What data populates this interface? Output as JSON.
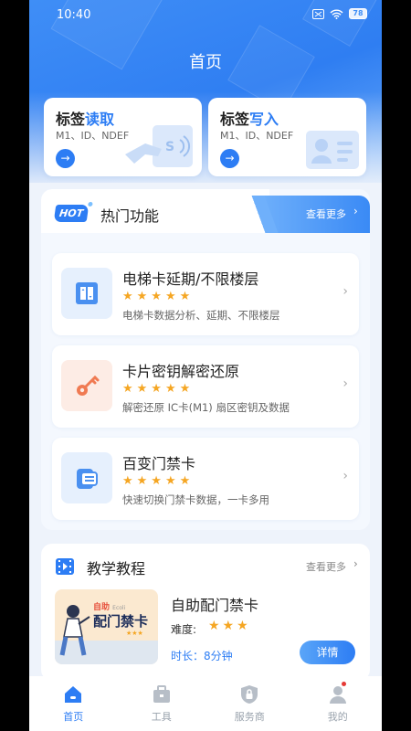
{
  "status_bar": {
    "time": "10:40",
    "battery": "78"
  },
  "header": {
    "title": "首页"
  },
  "tag_cards": [
    {
      "title_prefix": "标签",
      "title_highlight": "读取",
      "subtitle": "M1、ID、NDEF"
    },
    {
      "title_prefix": "标签",
      "title_highlight": "写入",
      "subtitle": "M1、ID、NDEF"
    }
  ],
  "hot": {
    "badge": "HOT",
    "title": "热门功能",
    "more": "查看更多",
    "items": [
      {
        "name": "电梯卡延期/不限楼层",
        "stars": "★★★★★",
        "desc": "电梯卡数据分析、延期、不限楼层",
        "icon": "elevator-icon"
      },
      {
        "name": "卡片密钥解密还原",
        "stars": "★★★★★",
        "desc": "解密还原 IC卡(M1) 扇区密钥及数据",
        "icon": "key-icon"
      },
      {
        "name": "百变门禁卡",
        "stars": "★★★★★",
        "desc": "快速切换门禁卡数据，一卡多用",
        "icon": "card-switch-icon"
      }
    ]
  },
  "tutorial": {
    "title": "教学教程",
    "more": "查看更多",
    "thumb_brand": "自助",
    "thumb_brand_small": "Ecoli",
    "thumb_title": "配门禁卡",
    "item_name": "自助配门禁卡",
    "difficulty_label": "难度:",
    "difficulty_stars": "★★★",
    "duration": "时长：8分钟",
    "detail_button": "详情"
  },
  "bottom_nav": [
    {
      "label": "首页",
      "icon": "home-icon",
      "active": true
    },
    {
      "label": "工具",
      "icon": "toolbox-icon",
      "active": false
    },
    {
      "label": "服务商",
      "icon": "shield-lock-icon",
      "active": false
    },
    {
      "label": "我的",
      "icon": "user-icon",
      "active": false
    }
  ],
  "colors": {
    "primary": "#2d7df4",
    "star": "#f5a623",
    "background": "#eef3fb"
  }
}
